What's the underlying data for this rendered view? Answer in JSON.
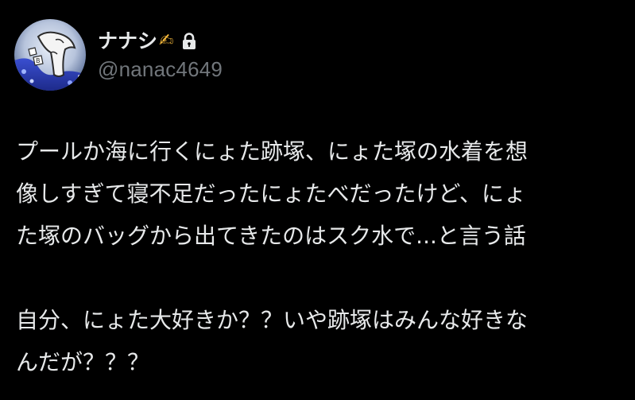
{
  "author": {
    "display_name": "ナナシ",
    "name_emoji": "✍",
    "handle": "@nanac4649",
    "lock_icon": "lock-icon",
    "protected_color": "#e7e9ea"
  },
  "post": {
    "lines": [
      "プールか海に行くにょた跡塚、にょた塚の水着を想",
      "像しすぎて寝不足だったにょたべだったけど、にょ",
      "た塚のバッグから出てきたのはスク水で...と言う話",
      "",
      "自分、にょた大好きか？？いや跡塚はみんな好きな",
      "んだが？？？"
    ]
  },
  "colors": {
    "background": "#000000",
    "text": "#e7e9ea",
    "secondary": "#71767b",
    "emoji": "#f5b83b"
  }
}
